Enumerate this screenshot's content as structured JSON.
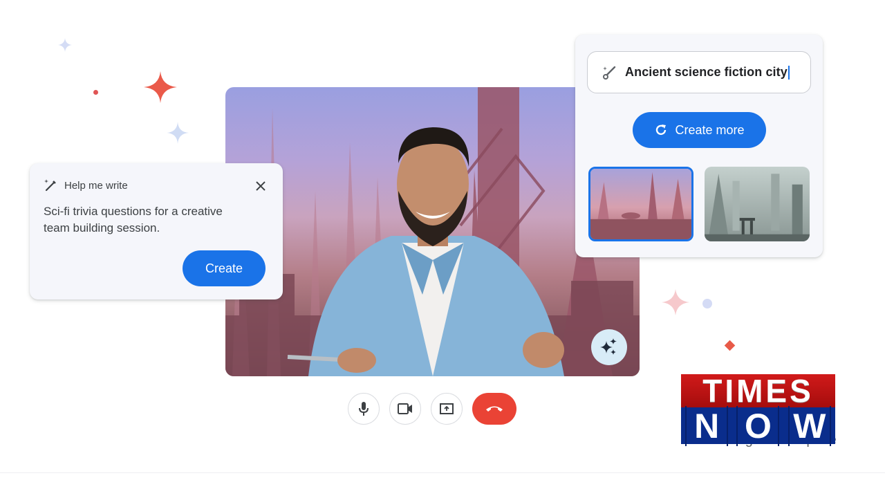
{
  "help_me_write": {
    "title": "Help me write",
    "icon": "magic-pen-icon",
    "close_icon": "close-icon",
    "prompt_text": "Sci-fi trivia questions for a creative team building session.",
    "create_label": "Create"
  },
  "image_generator": {
    "input_icon": "magic-brush-icon",
    "prompt_value": "Ancient science fiction city",
    "create_more_label": "Create more",
    "create_more_icon": "refresh-icon",
    "thumbnails": [
      {
        "label": "Pink sci-fi city",
        "selected": true
      },
      {
        "label": "Grey sci-fi ruins",
        "selected": false
      }
    ]
  },
  "video": {
    "background": "Ancient sci-fi city backdrop",
    "effects_icon": "sparkle-icon"
  },
  "call_controls": [
    {
      "name": "microphone",
      "icon": "mic-icon"
    },
    {
      "name": "camera",
      "icon": "video-camera-icon"
    },
    {
      "name": "present",
      "icon": "present-screen-icon"
    },
    {
      "name": "leave-call",
      "icon": "hang-up-icon"
    }
  ],
  "watermark": {
    "line1": "TIMES",
    "line2": [
      "N",
      "O",
      "W"
    ],
    "partial_text": "Google Workspace"
  },
  "colors": {
    "accent_blue": "#1a73e8",
    "hangup_red": "#ea4335",
    "card_bg": "#f5f6fb"
  }
}
